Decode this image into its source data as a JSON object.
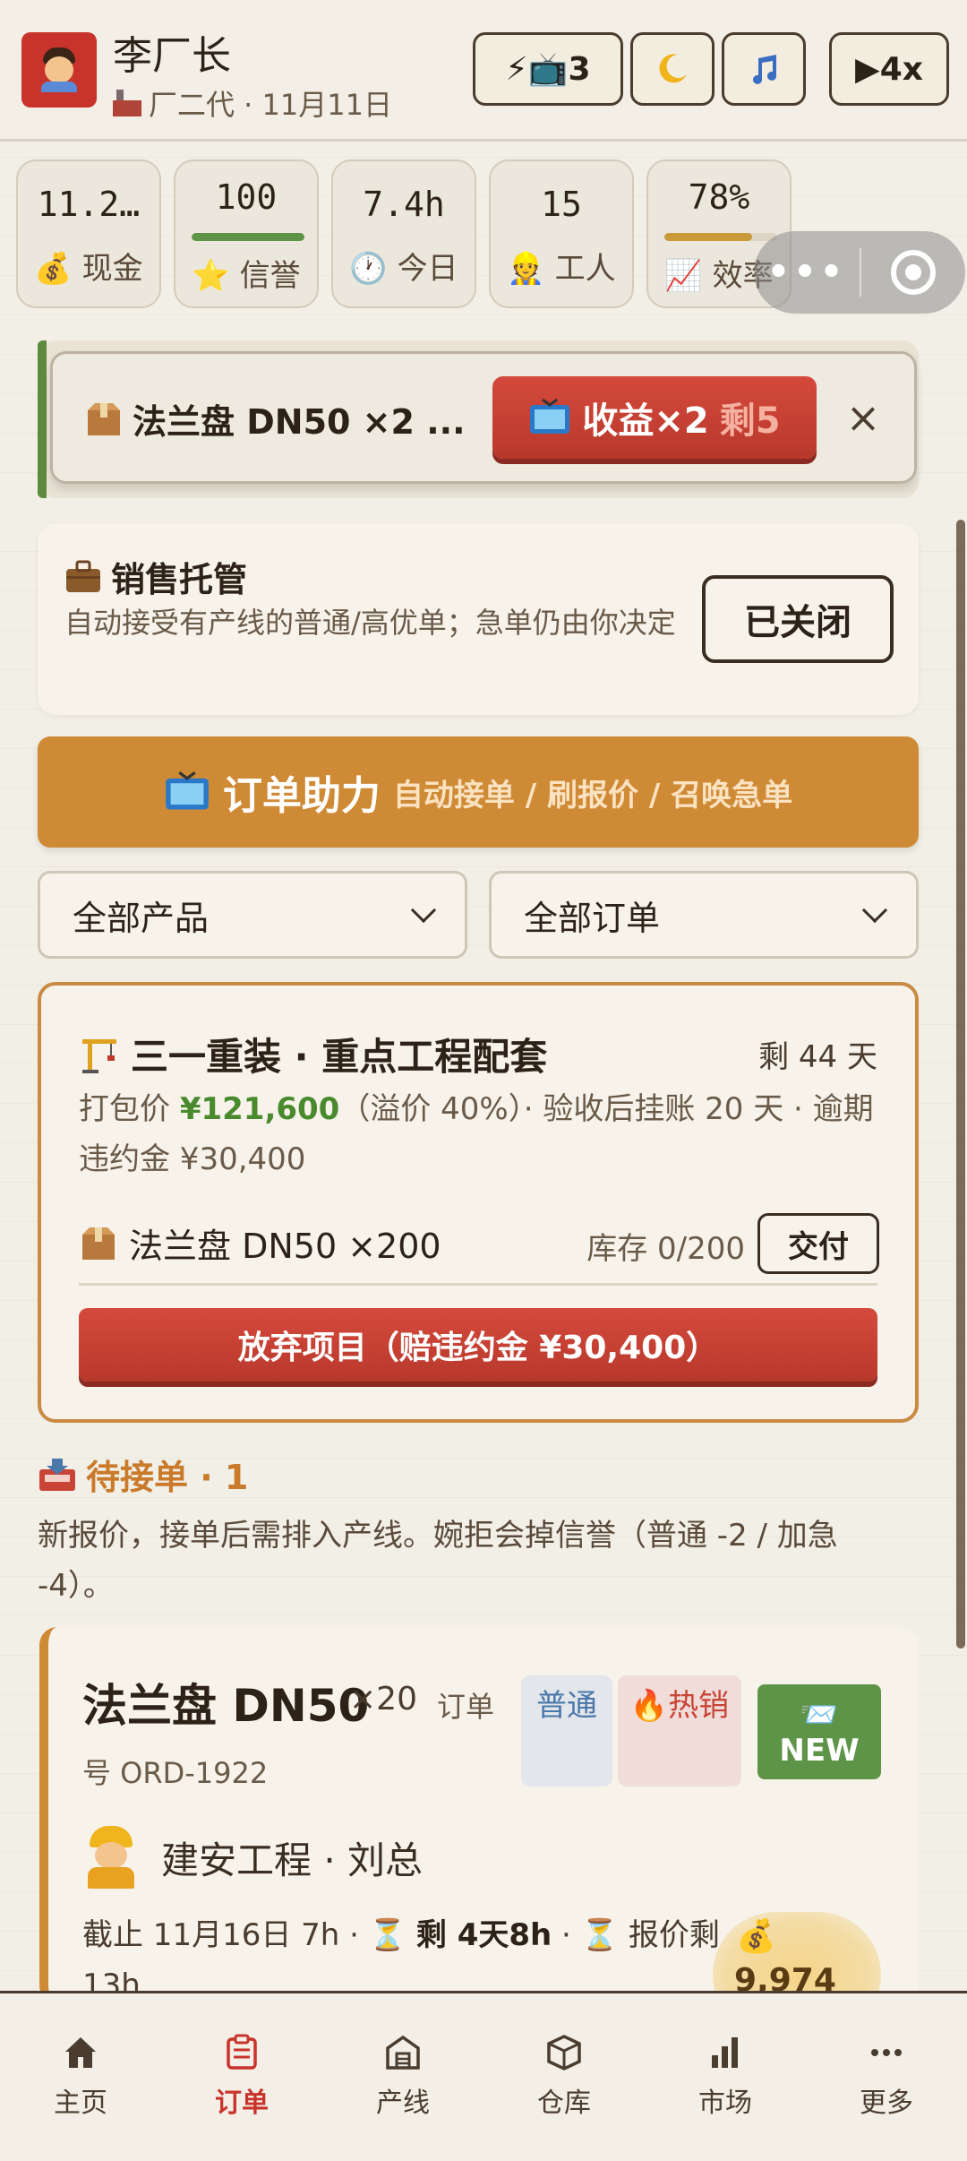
{
  "header": {
    "player_name": "李厂长",
    "subtitle": "厂二代 · 11月11日",
    "ad_button": "⚡📺3",
    "speed_button": "▶4x"
  },
  "stats": [
    {
      "value": "11.2…",
      "label": "💰 现金"
    },
    {
      "value": "100",
      "label": "⭐ 信誉",
      "bar_fraction": 1.0,
      "bar_color": "#5e9448"
    },
    {
      "value": "7.4h",
      "label": "🕐 今日"
    },
    {
      "value": "15",
      "label": "👷 工人"
    },
    {
      "value": "78%",
      "label": "📈 效率",
      "bar_fraction": 0.78,
      "bar_color": "#c99a3a"
    }
  ],
  "capsule": {
    "dots": "•••"
  },
  "toast": {
    "text": "法兰盘 DN50 ×2 ...",
    "button_main": "收益×2",
    "button_remaining": "剩5",
    "close": "×"
  },
  "sales": {
    "title": "销售托管",
    "desc": "自动接受有产线的普通/高优单；急单仍由你决定",
    "button": "已关闭"
  },
  "assist": {
    "main": "订单助力",
    "sub": "自动接单 / 刷报价 / 召唤急单"
  },
  "filters": {
    "product": "全部产品",
    "order": "全部订单"
  },
  "project": {
    "title": "三一重装 · 重点工程配套",
    "days_left": "剩 44 天",
    "desc_prefix": "打包价 ",
    "price": "¥121,600",
    "desc_suffix": "（溢价 40%）· 验收后挂账 20 天 · 逾期违约金 ¥30,400",
    "item": "法兰盘 DN50 ×200",
    "stock": "库存 0/200",
    "deliver": "交付",
    "abandon": "放弃项目（赔违约金 ¥30,400）"
  },
  "pending": {
    "title": "待接单 · 1",
    "desc": "新报价，接单后需排入产线。婉拒会掉信誉（普通 -2 / 加急 -4）。"
  },
  "order": {
    "name": "法兰盘 DN50",
    "qty": "×20",
    "order_no_a": "订单",
    "order_no_b": "号 ORD-1922",
    "tag_normal": "普通",
    "tag_hot": "🔥热销",
    "tag_new_icon": "📨",
    "tag_new": "NEW",
    "customer": "建安工程 · 刘总",
    "deadline_a": "截止 11月16日 7h · ⏳ ",
    "deadline_b": "剩 4天8h",
    "deadline_c": " · ⏳ 报价剩 13h",
    "money": "9,974",
    "money_icon": "💰"
  },
  "nav": [
    {
      "label": "主页",
      "icon": "home-icon"
    },
    {
      "label": "订单",
      "icon": "orders-icon",
      "active": true
    },
    {
      "label": "产线",
      "icon": "factory-icon"
    },
    {
      "label": "仓库",
      "icon": "box-icon"
    },
    {
      "label": "市场",
      "icon": "chart-icon"
    },
    {
      "label": "更多",
      "icon": "more-icon"
    }
  ]
}
